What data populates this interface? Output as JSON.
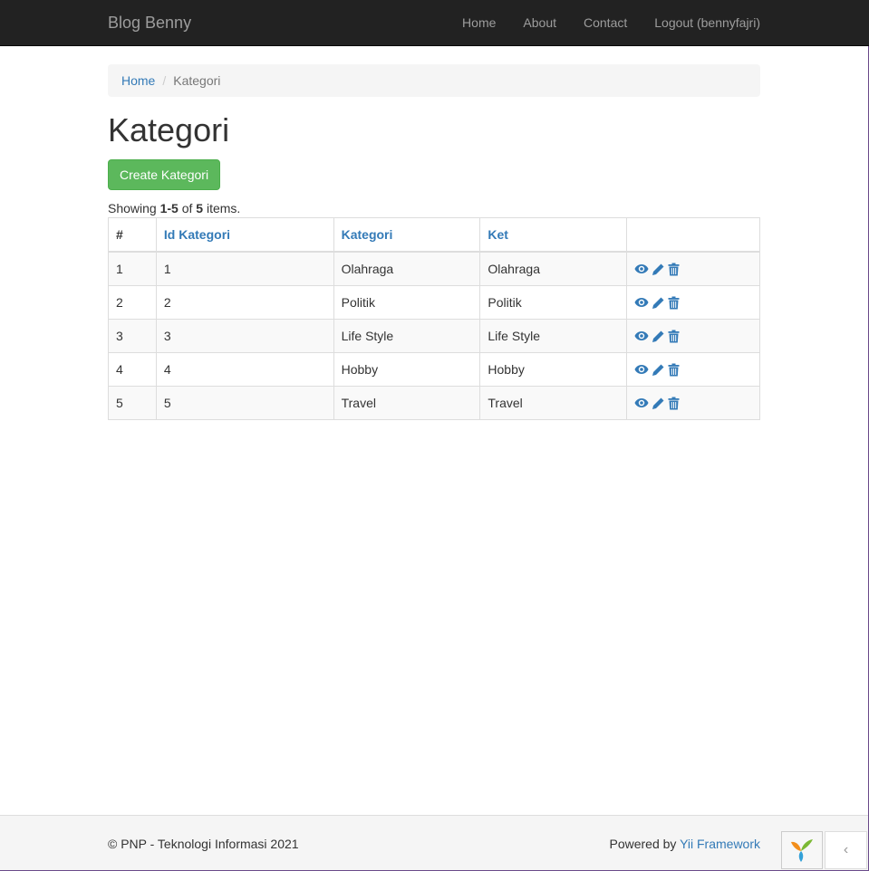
{
  "navbar": {
    "brand": "Blog Benny",
    "items": [
      {
        "label": "Home"
      },
      {
        "label": "About"
      },
      {
        "label": "Contact"
      },
      {
        "label": "Logout (bennyfajri)"
      }
    ]
  },
  "breadcrumb": {
    "home": "Home",
    "separator": "/",
    "current": "Kategori"
  },
  "page": {
    "title": "Kategori",
    "create_button": "Create Kategori"
  },
  "summary": {
    "prefix": "Showing ",
    "range": "1-5",
    "of": " of ",
    "total": "5",
    "suffix": " items."
  },
  "table": {
    "headers": [
      "#",
      "Id Kategori",
      "Kategori",
      "Ket",
      ""
    ],
    "rows": [
      {
        "num": "1",
        "id": "1",
        "kategori": "Olahraga",
        "ket": "Olahraga"
      },
      {
        "num": "2",
        "id": "2",
        "kategori": "Politik",
        "ket": "Politik"
      },
      {
        "num": "3",
        "id": "3",
        "kategori": "Life Style",
        "ket": "Life Style"
      },
      {
        "num": "4",
        "id": "4",
        "kategori": "Hobby",
        "ket": "Hobby"
      },
      {
        "num": "5",
        "id": "5",
        "kategori": "Travel",
        "ket": "Travel"
      }
    ],
    "row_actions": [
      "eye-icon",
      "pencil-icon",
      "trash-icon"
    ]
  },
  "footer": {
    "copyright": "© PNP - Teknologi Informasi 2021",
    "powered_prefix": "Powered by ",
    "powered_link": "Yii Framework"
  },
  "debug_toolbar": {
    "logo_icon": "yii-logo-icon",
    "toggle_icon": "chevron-left-icon",
    "toggle_glyph": "‹"
  },
  "colors": {
    "navbar_bg": "#222222",
    "link": "#337ab7",
    "success": "#5cb85c"
  }
}
